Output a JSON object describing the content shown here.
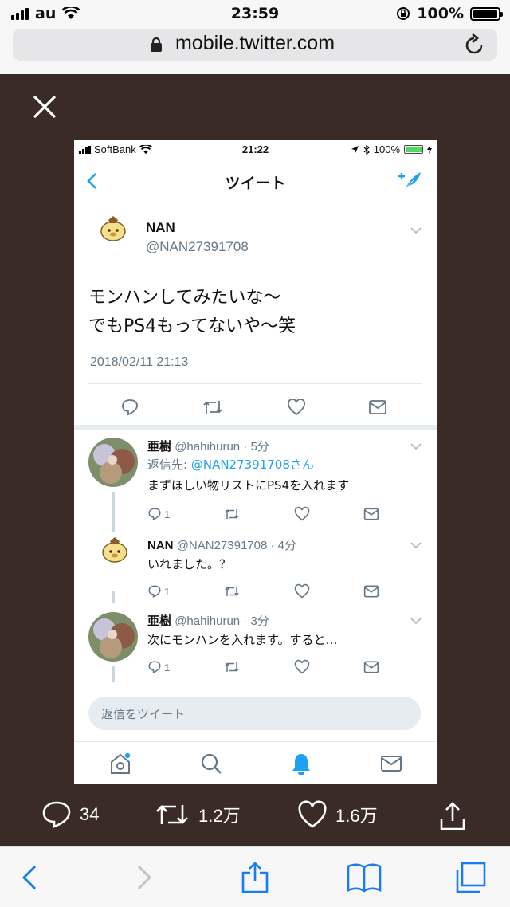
{
  "outer_status": {
    "carrier": "au",
    "time": "23:59",
    "battery": "100%"
  },
  "browser": {
    "url": "mobile.twitter.com"
  },
  "inner_status": {
    "carrier": "SoftBank",
    "time": "21:22",
    "battery": "100%"
  },
  "header": {
    "title": "ツイート"
  },
  "main_tweet": {
    "name": "NAN",
    "handle": "@NAN27391708",
    "text_line1": "モンハンしてみたいな〜",
    "text_line2": "でもPS4もってないや〜笑",
    "date": "2018/02/11 21:13"
  },
  "replies": [
    {
      "name": "亜樹",
      "meta": "@hahihurun · 5分",
      "reply_label": "返信先:",
      "reply_to": "@NAN27391708さん",
      "text": "まずほしい物リストにPS4を入れます",
      "reply_count": "1"
    },
    {
      "name": "NAN",
      "meta": "@NAN27391708 · 4分",
      "text": "いれました。？",
      "reply_count": "1"
    },
    {
      "name": "亜樹",
      "meta": "@hahihurun · 3分",
      "text": "次にモンハンを入れます。すると…",
      "reply_count": "1"
    }
  ],
  "reply_box": {
    "placeholder": "返信をツイート"
  },
  "counters": {
    "replies": "34",
    "retweets": "1.2万",
    "likes": "1.6万"
  },
  "colors": {
    "twitter_blue": "#1da1f2",
    "gray": "#657786",
    "background": "#3b2b26"
  }
}
